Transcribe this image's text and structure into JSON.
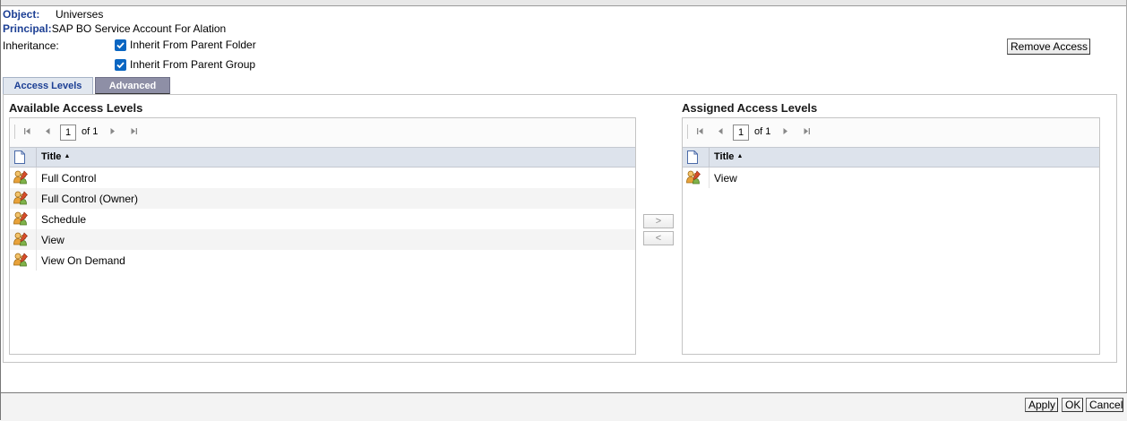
{
  "object": {
    "label": "Object:",
    "value": "Universes"
  },
  "principal": {
    "label": "Principal:",
    "value": "SAP BO Service Account For Alation"
  },
  "inheritance": {
    "label": "Inheritance:",
    "options": [
      {
        "label": "Inherit From Parent Folder",
        "checked": true
      },
      {
        "label": "Inherit From Parent Group",
        "checked": true
      }
    ]
  },
  "remove_access_label": "Remove Access",
  "tabs": [
    {
      "label": "Access Levels",
      "active": true
    },
    {
      "label": "Advanced",
      "active": false
    }
  ],
  "available": {
    "title": "Available Access Levels",
    "pager": {
      "page": "1",
      "of_label": "of 1"
    },
    "column": "Title",
    "sort_glyph": "▲",
    "rows": [
      "Full Control",
      "Full Control (Owner)",
      "Schedule",
      "View",
      "View On Demand"
    ]
  },
  "assigned": {
    "title": "Assigned Access Levels",
    "pager": {
      "page": "1",
      "of_label": "of 1"
    },
    "column": "Title",
    "sort_glyph": "▲",
    "rows": [
      "View"
    ]
  },
  "move": {
    "add_label": ">",
    "remove_label": "<"
  },
  "footer": {
    "apply": "Apply",
    "ok": "OK",
    "cancel": "Cancel"
  },
  "icons": {
    "row_icon": "access-level-users-icon",
    "header_icon": "page-icon",
    "pager": [
      "first-page-icon",
      "prev-page-icon",
      "next-page-icon",
      "last-page-icon"
    ]
  },
  "colors": {
    "label_blue": "#1c3f94",
    "checkbox": "#0a66c2",
    "tab_advanced": "#8e8fa6",
    "grid_header": "#dde3ec"
  }
}
